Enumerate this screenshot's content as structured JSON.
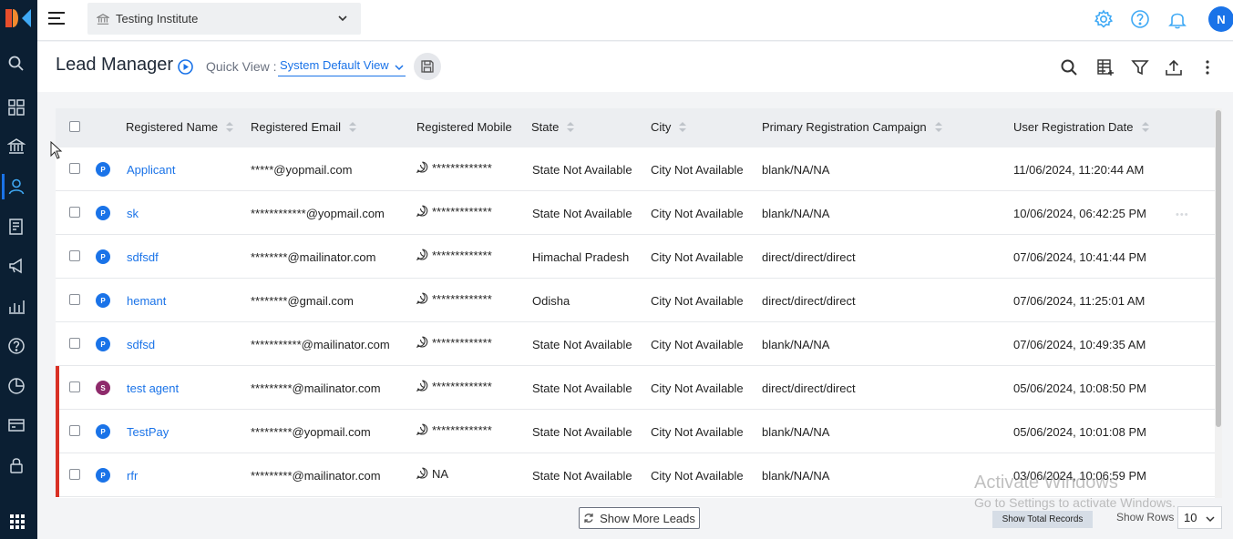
{
  "topbar": {
    "institute": "Testing Institute",
    "avatar_initial": "N"
  },
  "header": {
    "title": "Lead Manager",
    "quick_view_label": "Quick View :",
    "quick_view_value": "System Default View"
  },
  "table": {
    "columns": [
      "Registered Name",
      "Registered Email",
      "Registered Mobile",
      "State",
      "City",
      "Primary Registration Campaign",
      "User Registration Date"
    ],
    "rows": [
      {
        "badge": "P",
        "name": "Applicant",
        "email": "*****@yopmail.com",
        "mobile": "*************",
        "state": "State Not Available",
        "city": "City Not Available",
        "campaign": "blank/NA/NA",
        "date": "11/06/2024, 11:20:44 AM",
        "flag": false
      },
      {
        "badge": "P",
        "name": "sk",
        "email": "************@yopmail.com",
        "mobile": "*************",
        "state": "State Not Available",
        "city": "City Not Available",
        "campaign": "blank/NA/NA",
        "date": "10/06/2024, 06:42:25 PM",
        "flag": false
      },
      {
        "badge": "P",
        "name": "sdfsdf",
        "email": "********@mailinator.com",
        "mobile": "*************",
        "state": "Himachal Pradesh",
        "city": "City Not Available",
        "campaign": "direct/direct/direct",
        "date": "07/06/2024, 10:41:44 PM",
        "flag": false
      },
      {
        "badge": "P",
        "name": "hemant",
        "email": "********@gmail.com",
        "mobile": "*************",
        "state": "Odisha",
        "city": "City Not Available",
        "campaign": "direct/direct/direct",
        "date": "07/06/2024, 11:25:01 AM",
        "flag": false
      },
      {
        "badge": "P",
        "name": "sdfsd",
        "email": "***********@mailinator.com",
        "mobile": "*************",
        "state": "State Not Available",
        "city": "City Not Available",
        "campaign": "blank/NA/NA",
        "date": "07/06/2024, 10:49:35 AM",
        "flag": false
      },
      {
        "badge": "S",
        "name": "test agent",
        "email": "*********@mailinator.com",
        "mobile": "*************",
        "state": "State Not Available",
        "city": "City Not Available",
        "campaign": "direct/direct/direct",
        "date": "05/06/2024, 10:08:50 PM",
        "flag": true
      },
      {
        "badge": "P",
        "name": "TestPay",
        "email": "*********@yopmail.com",
        "mobile": "*************",
        "state": "State Not Available",
        "city": "City Not Available",
        "campaign": "blank/NA/NA",
        "date": "05/06/2024, 10:01:08 PM",
        "flag": true
      },
      {
        "badge": "P",
        "name": "rfr",
        "email": "*********@mailinator.com",
        "mobile": "NA",
        "state": "State Not Available",
        "city": "City Not Available",
        "campaign": "blank/NA/NA",
        "date": "03/06/2024, 10:06:59 PM",
        "flag": true
      }
    ],
    "row_actions": "•••"
  },
  "footer": {
    "show_more": "Show More Leads",
    "show_total": "Show Total Records",
    "rows_label": "Show Rows",
    "rows_value": "10"
  },
  "watermark": {
    "line1": "Activate Windows",
    "line2": "Go to Settings to activate Windows."
  },
  "colors": {
    "rail": "#0b1f33",
    "accent": "#1a73e8",
    "badge_p": "#1a73e8",
    "badge_s": "#8e2a6b",
    "flag": "#d93025"
  },
  "icons": {
    "rail": [
      "search-icon",
      "dashboard-icon",
      "institute-icon",
      "user-icon",
      "form-icon",
      "megaphone-icon",
      "analytics-icon",
      "help-icon",
      "pie-chart-icon",
      "payment-icon",
      "lock-icon",
      "apps-grid-icon"
    ],
    "topbar": [
      "settings-icon",
      "help-icon",
      "bell-icon"
    ],
    "header": [
      "search-icon",
      "add-column-icon",
      "filter-icon",
      "upload-icon",
      "more-vertical-icon"
    ]
  }
}
